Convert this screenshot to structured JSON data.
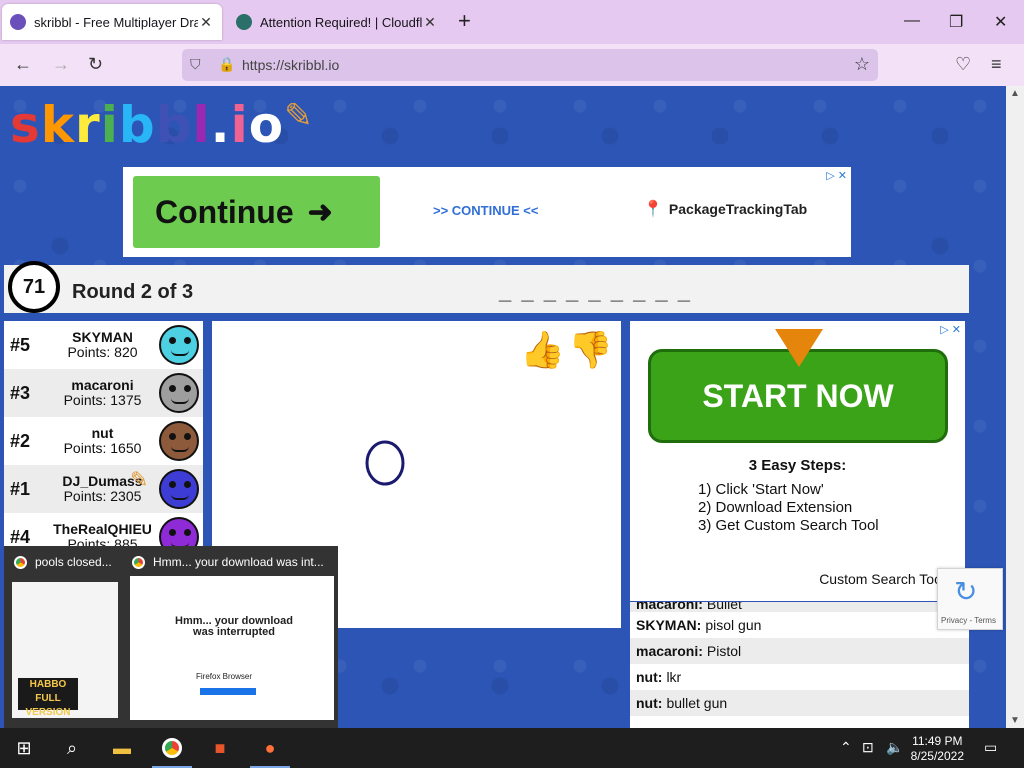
{
  "browser": {
    "tabs": [
      {
        "title": "skribbl - Free Multiplayer Drawin",
        "active": true
      },
      {
        "title": "Attention Required! | Cloudflare",
        "active": false
      }
    ],
    "url": "https://skribbl.io"
  },
  "page": {
    "logo_letters": [
      "s",
      "k",
      "r",
      "i",
      "b",
      "b",
      "l",
      ".",
      "i",
      "o"
    ],
    "top_ad": {
      "button_label": "Continue",
      "link_text": ">> CONTINUE <<",
      "brand": "PackageTrackingTab"
    },
    "round": {
      "timer": "71",
      "label": "Round 2 of 3",
      "word_hint": "_ _ _ _ _ _ _ _ _"
    },
    "players": [
      {
        "rank": "#5",
        "name": "SKYMAN",
        "points": "Points: 820",
        "color": "#4dd0e1"
      },
      {
        "rank": "#3",
        "name": "macaroni",
        "points": "Points: 1375",
        "color": "#9e9e9e"
      },
      {
        "rank": "#2",
        "name": "nut",
        "points": "Points: 1650",
        "color": "#8d5a3b"
      },
      {
        "rank": "#1",
        "name": "DJ_Dumass",
        "points": "Points: 2305",
        "color": "#3d3dd6"
      },
      {
        "rank": "#4",
        "name": "TheRealQHIEU",
        "points": "Points: 885",
        "color": "#8e2ad6"
      }
    ],
    "right_ad": {
      "button_label": "START NOW",
      "steps_title": "3 Easy Steps:",
      "steps": [
        "1)  Click 'Start Now'",
        "2)  Download Extension",
        "3)  Get Custom Search Tool"
      ],
      "footer": "Custom Search Tool"
    },
    "chat": [
      {
        "name": "macaroni:",
        "text": "Bullet"
      },
      {
        "name": "SKYMAN:",
        "text": "pisol gun"
      },
      {
        "name": "macaroni:",
        "text": "Pistol"
      },
      {
        "name": "nut:",
        "text": "lkr"
      },
      {
        "name": "nut:",
        "text": "bullet gun"
      }
    ],
    "recaptcha_terms": "Privacy - Terms"
  },
  "popup": {
    "tab1": "pools closed...",
    "tab2": "Hmm... your download was int...",
    "thumb_heading": "Hmm... your download was interrupted",
    "thumb_browser": "Firefox Browser",
    "thumb_game": "HABBO FULL VERSION"
  },
  "taskbar": {
    "time": "11:49 PM",
    "date": "8/25/2022"
  }
}
